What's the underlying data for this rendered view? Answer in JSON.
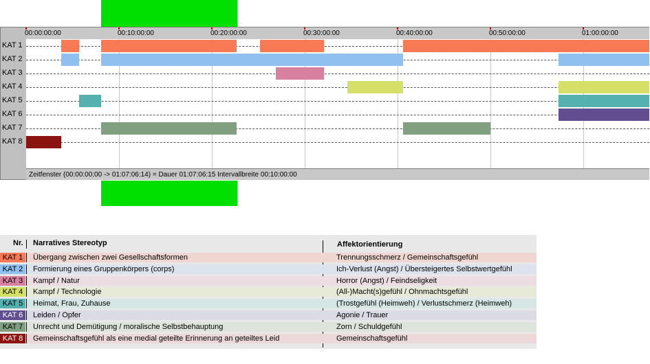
{
  "timeline": {
    "ticks": [
      "00:00:00:00",
      "00:10:00:00",
      "00:20:00:00",
      "00:30:00:00",
      "00:40:00:00",
      "00:50:00:00",
      "01:00:00:00"
    ],
    "rows": [
      "KAT 1",
      "KAT 2",
      "KAT 3",
      "KAT 4",
      "KAT 5",
      "KAT 6",
      "KAT 7",
      "KAT 8"
    ],
    "status": "Zeitfenster (00:00:00:00 -> 01:07:06:14) = Dauer 01:07:06:15    Intervallbreite 00:10:00:00",
    "colors": {
      "KAT 1": "#f77a55",
      "KAT 2": "#90c0f0",
      "KAT 3": "#d880a0",
      "KAT 4": "#d4e068",
      "KAT 5": "#55b0b0",
      "KAT 6": "#604e90",
      "KAT 7": "#80a080",
      "KAT 8": "#8b1410"
    },
    "segments_minutes": {
      "KAT 1": [
        [
          3.8,
          5.7
        ],
        [
          8.1,
          22.7
        ],
        [
          25.2,
          32.1
        ],
        [
          40.6,
          67.1
        ]
      ],
      "KAT 2": [
        [
          3.8,
          5.7
        ],
        [
          8.1,
          40.6
        ],
        [
          57.3,
          67.1
        ]
      ],
      "KAT 3": [
        [
          26.9,
          32.1
        ]
      ],
      "KAT 4": [
        [
          34.6,
          40.6
        ],
        [
          57.3,
          67.1
        ]
      ],
      "KAT 5": [
        [
          5.7,
          8.1
        ],
        [
          57.3,
          67.1
        ]
      ],
      "KAT 6": [
        [
          57.3,
          67.1
        ]
      ],
      "KAT 7": [
        [
          8.1,
          22.7
        ],
        [
          40.6,
          50.0
        ]
      ],
      "KAT 8": [
        [
          0.0,
          3.8
        ]
      ]
    },
    "total_minutes": 67.1
  },
  "legend": {
    "headers": {
      "nr": "Nr.",
      "stereotyp": "Narratives Stereotyp",
      "affekt": "Affektorientierung"
    },
    "rows": [
      {
        "kat": "KAT 1",
        "stereotyp": "Übergang zwischen zwei Gesellschaftsformen",
        "affekt": "Trennungsschmerz / Gemeinschaftsgefühl",
        "bg": "#efd6d0"
      },
      {
        "kat": "KAT 2",
        "stereotyp": "Formierung eines Gruppenkörpers (corps)",
        "affekt": "Ich-Verlust (Angst) / Übersteigertes Selbstwertgefühl",
        "bg": "#dde3ec"
      },
      {
        "kat": "KAT 3",
        "stereotyp": "Kampf / Natur",
        "affekt": "Horror (Angst) / Feindseligkeit",
        "bg": "#ecdde2"
      },
      {
        "kat": "KAT 4",
        "stereotyp": "Kampf / Technologie",
        "affekt": "(All-)Macht(s)gefühl / Ohnmachtsgefühl",
        "bg": "#e8ead8"
      },
      {
        "kat": "KAT 5",
        "stereotyp": "Heimat, Frau, Zuhause",
        "affekt": "(Trostgefühl (Heimweh) / Verlustschmerz (Heimweh)",
        "bg": "#d6e6e4"
      },
      {
        "kat": "KAT 6",
        "stereotyp": "Leiden / Opfer",
        "affekt": "Agonie / Trauer",
        "bg": "#dcdae4"
      },
      {
        "kat": "KAT 7",
        "stereotyp": "Unrecht und Demütigung / moralische Selbstbehauptung",
        "affekt": "Zorn / Schuldgefühl",
        "bg": "#dde4dc"
      },
      {
        "kat": "KAT 8",
        "stereotyp": "Gemeinschaftsgefühl als eine medial geteilte Erinnerung an geteiltes Leid",
        "affekt": "Gemeinschaftsgefühl",
        "bg": "#ecd8d8"
      }
    ]
  }
}
